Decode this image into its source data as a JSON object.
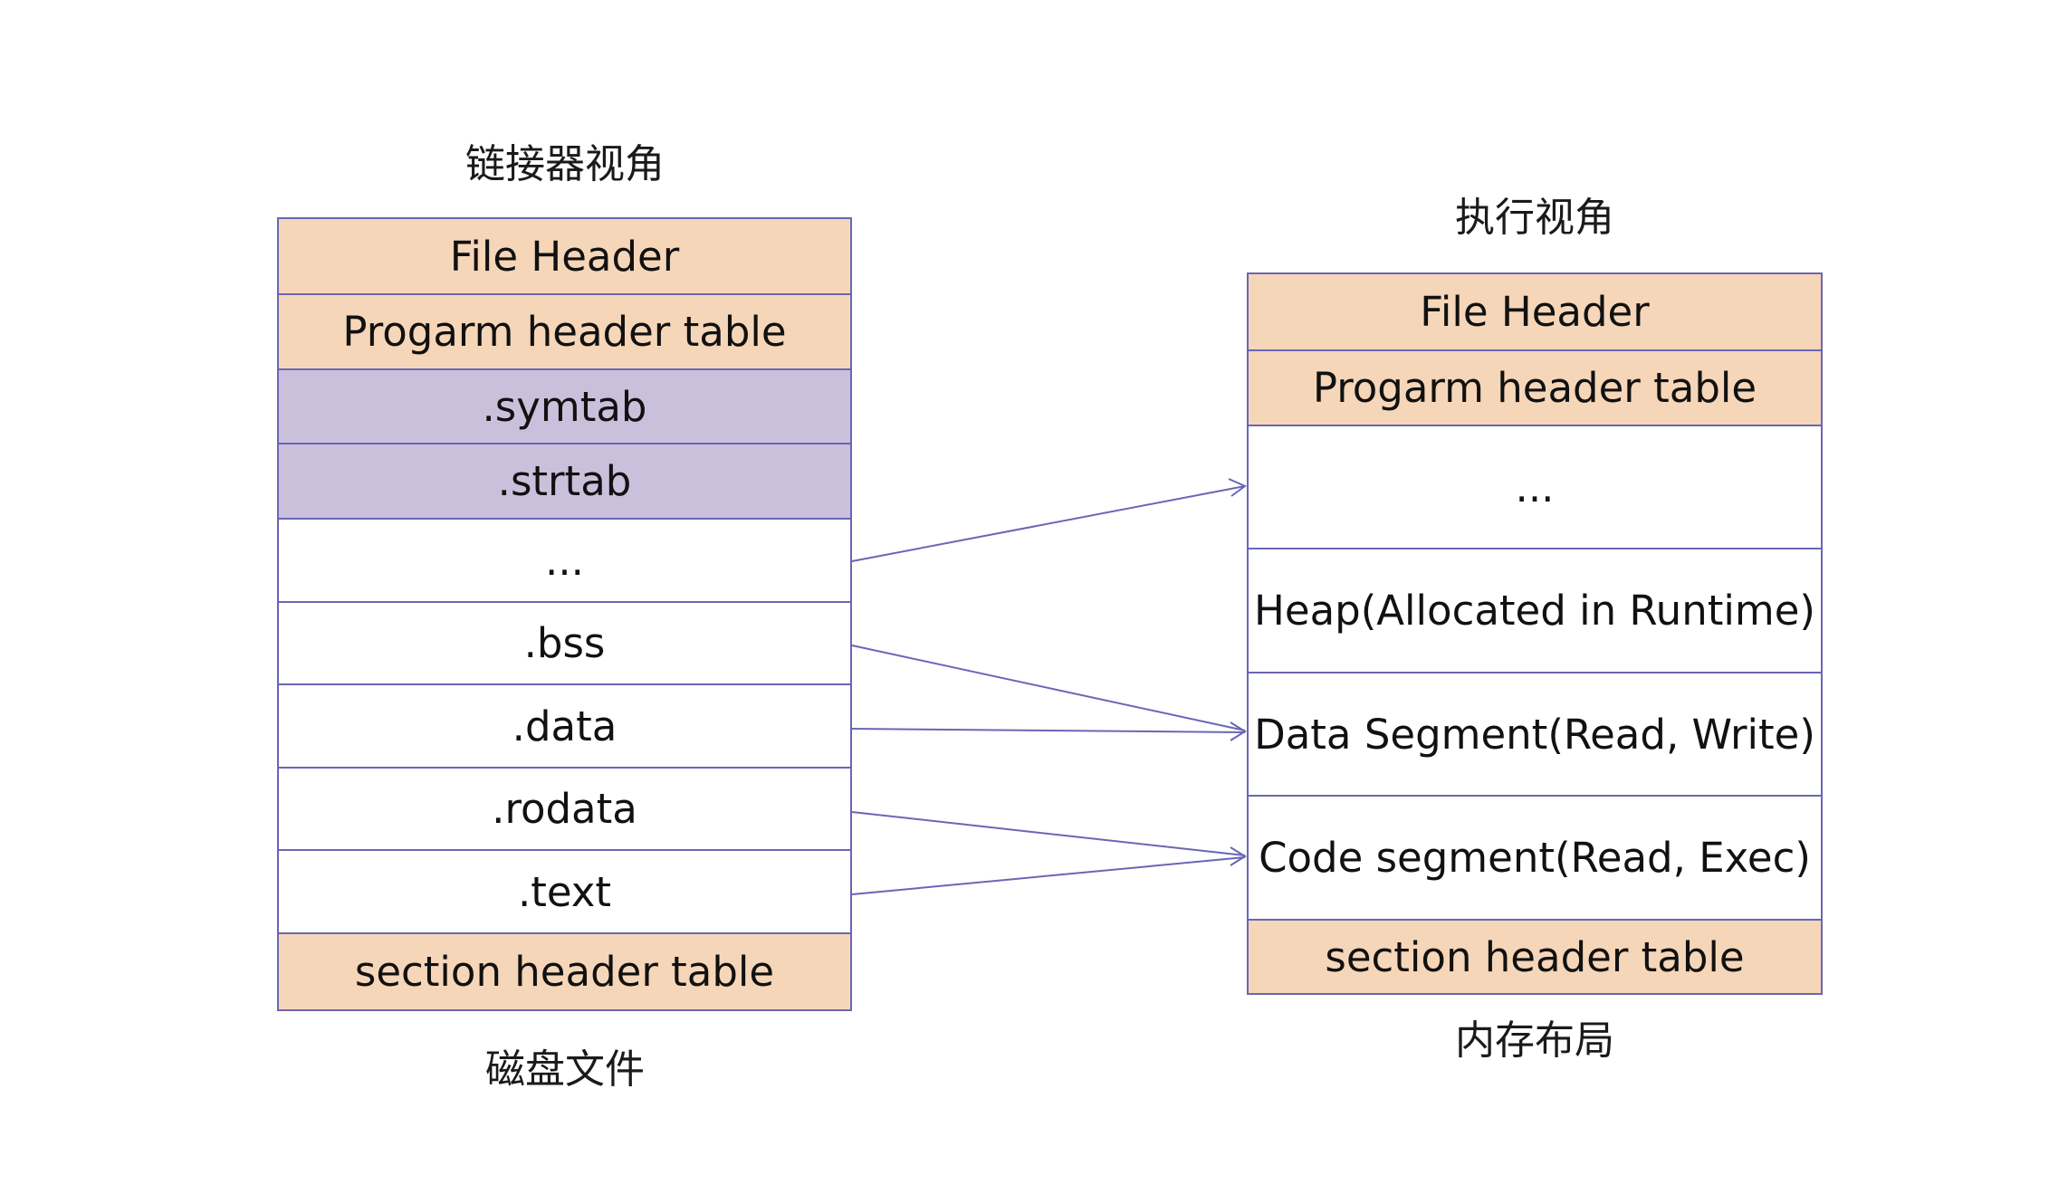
{
  "left": {
    "title": "链接器视角",
    "caption": "磁盘文件",
    "rows": [
      {
        "label": "File Header",
        "fill": "orange"
      },
      {
        "label": "Progarm header table",
        "fill": "orange"
      },
      {
        "label": ".symtab",
        "fill": "purple"
      },
      {
        "label": ".strtab",
        "fill": "purple"
      },
      {
        "label": "...",
        "fill": "white"
      },
      {
        "label": ".bss",
        "fill": "white"
      },
      {
        "label": ".data",
        "fill": "white"
      },
      {
        "label": ".rodata",
        "fill": "white"
      },
      {
        "label": ".text",
        "fill": "white"
      },
      {
        "label": "section header table",
        "fill": "orange"
      }
    ]
  },
  "right": {
    "title": "执行视角",
    "caption": "内存布局",
    "rows": [
      {
        "label": "File Header",
        "fill": "orange"
      },
      {
        "label": "Progarm header table",
        "fill": "orange"
      },
      {
        "label": "...",
        "fill": "white"
      },
      {
        "label": "Heap(Allocated in Runtime)",
        "fill": "white"
      },
      {
        "label": "Data Segment(Read, Write)",
        "fill": "white"
      },
      {
        "label": "Code segment(Read, Exec)",
        "fill": "white"
      },
      {
        "label": "section header table",
        "fill": "orange"
      }
    ]
  },
  "mappings": [
    {
      "from": "...",
      "to": "..."
    },
    {
      "from": ".bss",
      "to": "Data Segment(Read, Write)"
    },
    {
      "from": ".data",
      "to": "Data Segment(Read, Write)"
    },
    {
      "from": ".rodata",
      "to": "Code segment(Read, Exec)"
    },
    {
      "from": ".text",
      "to": "Code segment(Read, Exec)"
    }
  ],
  "colors": {
    "header_fill": "#f6d6b8",
    "symbol_fill": "#cbc0dc",
    "border": "#6a66b5",
    "arrow": "#6a66b5"
  }
}
